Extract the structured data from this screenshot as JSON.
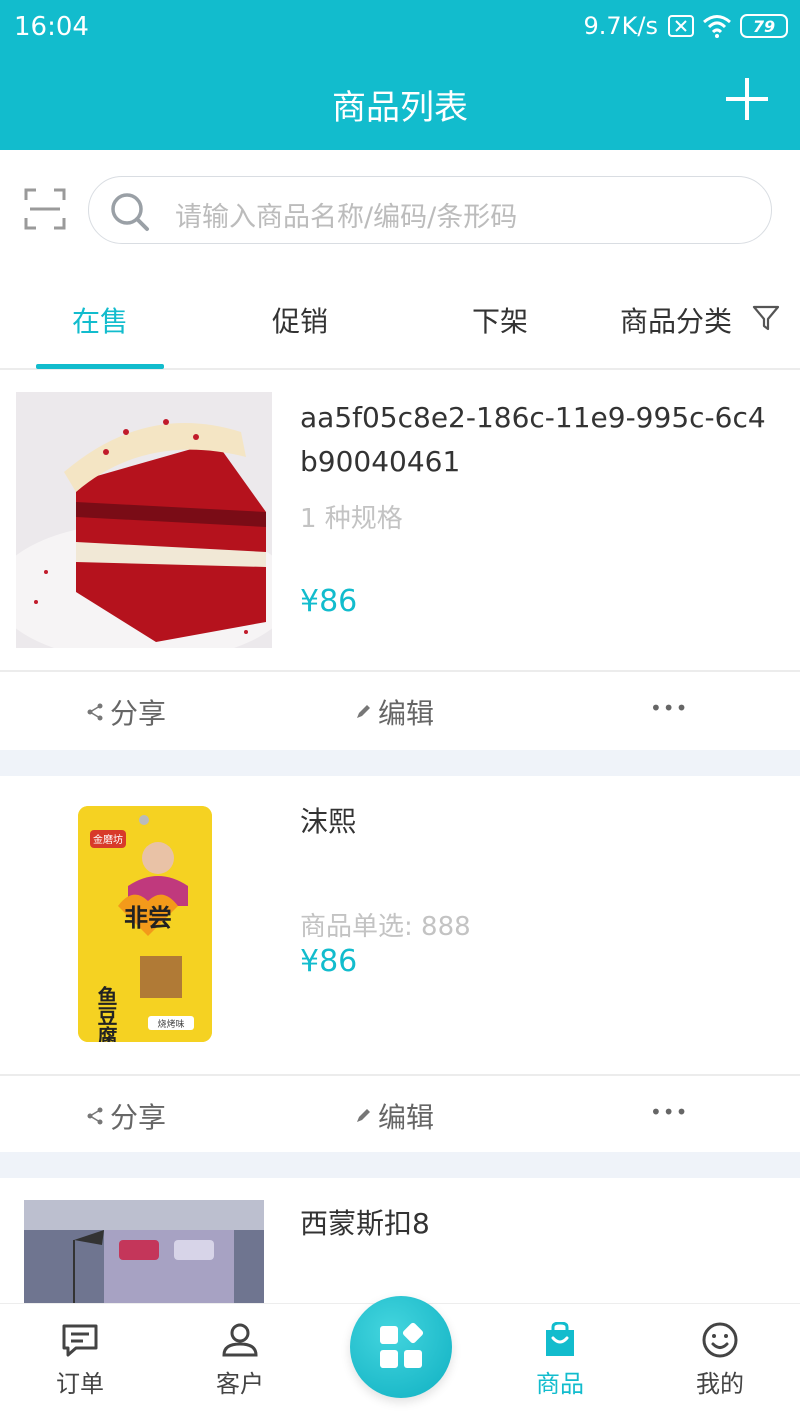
{
  "status_bar": {
    "time": "16:04",
    "net_speed": "9.7K/s",
    "battery": "79"
  },
  "header": {
    "title": "商品列表"
  },
  "search": {
    "placeholder": "请输入商品名称/编码/条形码"
  },
  "tabs": [
    {
      "label": "在售"
    },
    {
      "label": "促销"
    },
    {
      "label": "下架"
    },
    {
      "label": "商品分类"
    }
  ],
  "products": [
    {
      "name": "aa5f05c8e2-186c-11e9-995c-6c4b90040461",
      "spec": "1 种规格",
      "price": "¥86"
    },
    {
      "name": "沫熙",
      "spec": "商品单选: 888",
      "price": "¥86"
    },
    {
      "name": "西蒙斯扣8"
    }
  ],
  "product_actions": {
    "share": "分享",
    "edit": "编辑",
    "more": "•••"
  },
  "packaging_text": {
    "brand": "金磨坊",
    "slogan": "非尝",
    "product": "鱼豆腐",
    "flavor": "烧烤味"
  },
  "bottom_nav": [
    {
      "label": "订单"
    },
    {
      "label": "客户"
    },
    {
      "label": "商品"
    },
    {
      "label": "我的"
    }
  ],
  "colors": {
    "accent": "#12bccd",
    "separator": "#eff3f9"
  }
}
